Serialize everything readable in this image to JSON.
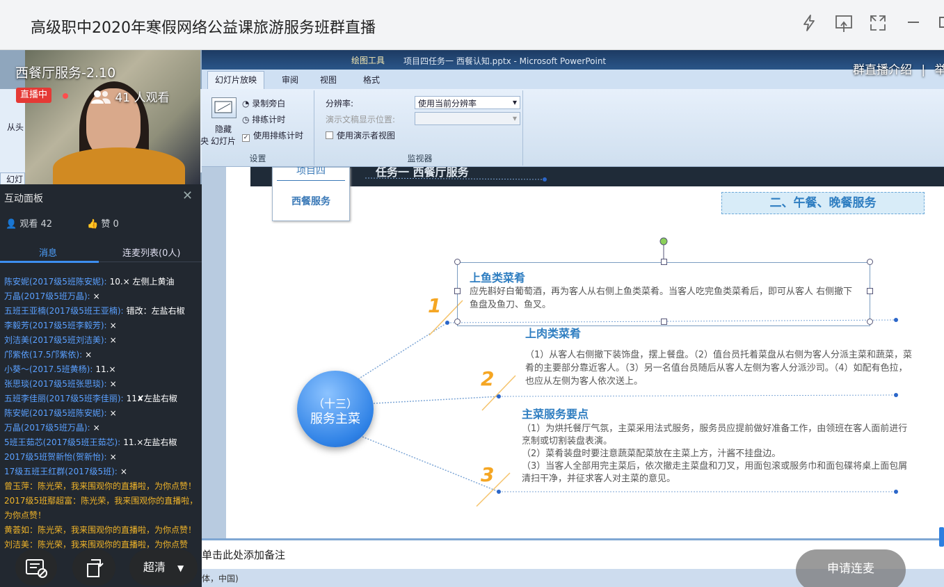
{
  "window": {
    "title": "高级职中2020年寒假网络公益课旅游服务班群直播"
  },
  "live": {
    "course_title": "西餐厅服务-2.10",
    "badge": "直播中",
    "viewers": "41 人观看",
    "intro_link": "群直播介绍",
    "intro_sep": "|",
    "intro_cut": "举"
  },
  "ppt": {
    "window_title": "项目四任务一   西餐认知.pptx - Microsoft PowerPoint",
    "context_tools": "绘图工具",
    "tabs": [
      "幻灯片放映",
      "审阅",
      "视图",
      "格式"
    ],
    "left_tab_fragment": "从头",
    "slides_tab_fragment": "幻灯",
    "hide_slide_label": "隐藏\n幻灯片",
    "hide_prefix": "央",
    "record_narration": "录制旁白",
    "rehearse": "排练计时",
    "use_timing": "使用排练计时",
    "group_setup": "设置",
    "resolution_label": "分辨率:",
    "resolution_value": "使用当前分辨率",
    "show_on_label": "演示文稿显示位置:",
    "presenter_view": "使用演示者视图",
    "group_monitor": "监视器",
    "notes_placeholder": "单击此处添加备注",
    "status_text": "体，中国)"
  },
  "slide": {
    "header_text": "任务一  西餐厅服务",
    "tab_top": "项目四",
    "tab_bottom": "西餐服务",
    "section_title": "二、午餐、晚餐服务",
    "center_line1": "（十三）",
    "center_line2": "服务主菜",
    "items": [
      {
        "num": "1",
        "title": "上鱼类菜肴",
        "text": "应先斟好白葡萄酒，再为客人从右侧上鱼类菜肴。当客人吃完鱼类菜肴后，即可从客人 右侧撤下鱼盘及鱼刀、鱼叉。"
      },
      {
        "num": "2",
        "title": "上肉类菜肴",
        "text": "（1）从客人右侧撤下装饰盘，摆上餐盘。（2）值台员托着菜盘从右侧为客人分派主菜和蔬菜，菜肴的主要部分靠近客人。（3）另一名值台员随后从客人左侧为客人分派沙司。（4）如配有色拉，也应从左侧为客人依次送上。"
      },
      {
        "num": "3",
        "title": "主菜服务要点",
        "text": "（1）为烘托餐厅气氛，主菜采用法式服务，服务员应提前做好准备工作，由领班在客人面前进行烹制或切割装盘表演。\n（2）菜肴装盘时要注意蔬菜配菜放在主菜上方，汁酱不挂盘边。\n（3）当客人全部用完主菜后，依次撤走主菜盘和刀叉，用面包滚或服务巾和面包碟将桌上面包屑清扫干净，并征求客人对主菜的意见。"
      }
    ]
  },
  "panel": {
    "title": "互动面板",
    "views": "观看 42",
    "likes": "赞 0",
    "tab_messages": "消息",
    "tab_mic": "连麦列表(0人)",
    "messages": [
      {
        "name": "陈安妮(2017级5班陈安妮):",
        "text": "10.× 左侧上黄油"
      },
      {
        "name": "万晶(2017级5班万晶):",
        "text": "×"
      },
      {
        "name": "五班王亚楠(2017级5班王亚楠):",
        "text": "错改：左盐右椒"
      },
      {
        "name": "李毅芳(2017级5班李毅芳):",
        "text": "×"
      },
      {
        "name": "刘洁美(2017级5班刘洁美):",
        "text": "×"
      },
      {
        "name": "邝紫依(17.5邝紫依):",
        "text": "×"
      },
      {
        "name": "小葵～(2017.5班黄杨):",
        "text": "11.×"
      },
      {
        "name": "张思琰(2017级5班张思琰):",
        "text": "×"
      },
      {
        "name": "五班李佳丽(2017级5班李佳丽):",
        "text": "11✘左盐右椒"
      },
      {
        "name": "陈安妮(2017级5班陈安妮):",
        "text": "×"
      },
      {
        "name": "万晶(2017级5班万晶):",
        "text": "×"
      },
      {
        "name": "5班王茹芯(2017级5班王茹芯):",
        "text": "11.×左盐右椒"
      },
      {
        "name": "2017级5班贺新怡(贺新怡):",
        "text": "×"
      },
      {
        "name": "17级五班王红群(2017级5班):",
        "text": "×"
      }
    ],
    "gold_messages": [
      {
        "name": "曾玉萍：",
        "text": "陈光荣，我来围观你的直播啦，为你点赞！"
      },
      {
        "name": "2017级5班鄢超富：",
        "text": "陈光荣，我来围观你的直播啦，为你点赞！"
      },
      {
        "name": "黄荟如：",
        "text": "陈光荣，我来围观你的直播啦，为你点赞！"
      },
      {
        "name": "刘洁美：",
        "text": "陈光荣，我来围观你的直播啦，为你点赞"
      }
    ]
  },
  "controls": {
    "quality": "超清",
    "apply_mic": "申请连麦"
  },
  "colors": {
    "accent_blue": "#2f7ec1",
    "live_red": "#e53935",
    "number_orange": "#f5a623"
  }
}
